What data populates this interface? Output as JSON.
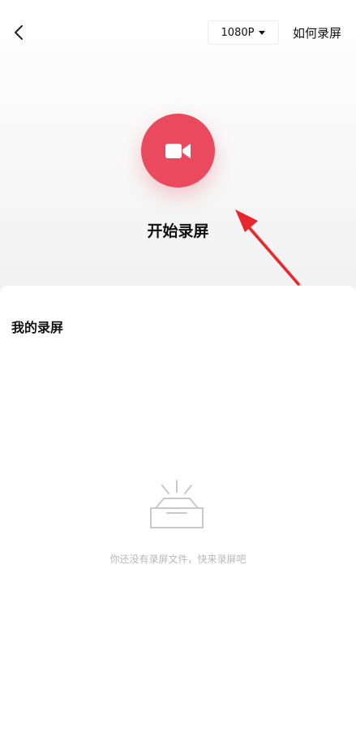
{
  "header": {
    "resolution": "1080P",
    "help_label": "如何录屏"
  },
  "record": {
    "label": "开始录屏"
  },
  "recordings": {
    "title": "我的录屏",
    "empty_message": "你还没有录屏文件，快来录屏吧"
  },
  "colors": {
    "accent": "#ea4a5e",
    "annotation_arrow": "#e8262e",
    "muted_text": "#b8b8b8"
  },
  "icons": {
    "back": "chevron-left-icon",
    "dropdown": "caret-down-icon",
    "record": "video-camera-icon",
    "empty": "empty-box-icon"
  }
}
